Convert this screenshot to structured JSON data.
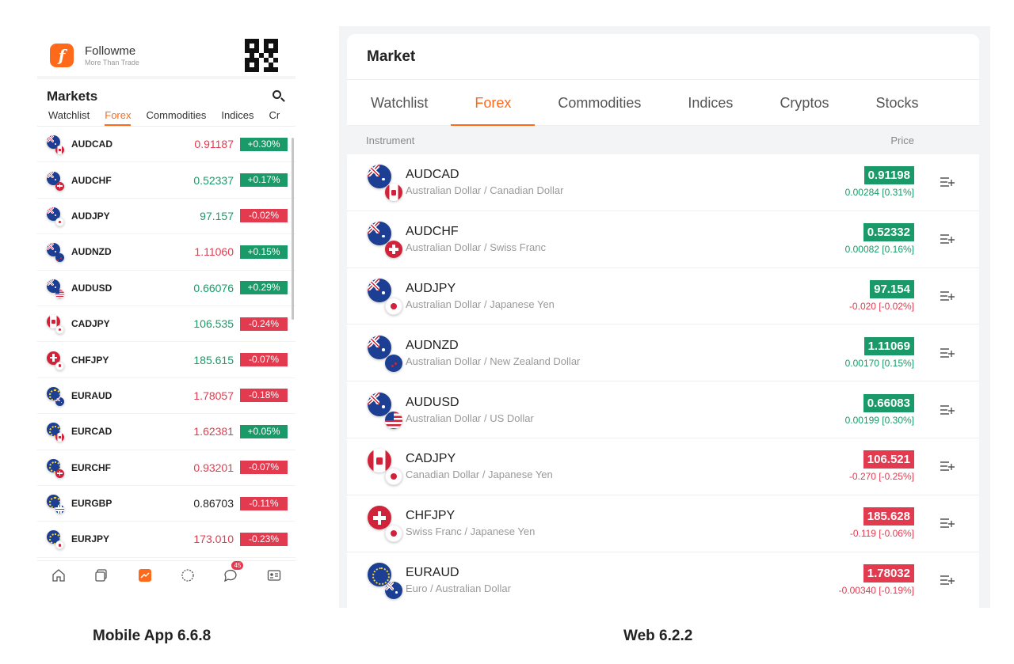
{
  "mobile": {
    "brand": {
      "name": "Followme",
      "tagline": "More Than Trade",
      "logo_icon": "followme-logo-icon"
    },
    "title": "Markets",
    "tabs": [
      {
        "label": "Watchlist"
      },
      {
        "label": "Forex",
        "active": true
      },
      {
        "label": "Commodities"
      },
      {
        "label": "Indices"
      },
      {
        "label": "Cr"
      }
    ],
    "rows": [
      {
        "symbol": "AUDCAD",
        "price": "0.91187",
        "price_dir": "dn",
        "change": "+0.30%",
        "change_dir": "up",
        "flags": [
          "au",
          "ca"
        ]
      },
      {
        "symbol": "AUDCHF",
        "price": "0.52337",
        "price_dir": "up",
        "change": "+0.17%",
        "change_dir": "up",
        "flags": [
          "au",
          "ch"
        ]
      },
      {
        "symbol": "AUDJPY",
        "price": "97.157",
        "price_dir": "up",
        "change": "-0.02%",
        "change_dir": "dn",
        "flags": [
          "au",
          "jp"
        ]
      },
      {
        "symbol": "AUDNZD",
        "price": "1.11060",
        "price_dir": "dn",
        "change": "+0.15%",
        "change_dir": "up",
        "flags": [
          "au",
          "nz"
        ]
      },
      {
        "symbol": "AUDUSD",
        "price": "0.66076",
        "price_dir": "up",
        "change": "+0.29%",
        "change_dir": "up",
        "flags": [
          "au",
          "us"
        ]
      },
      {
        "symbol": "CADJPY",
        "price": "106.535",
        "price_dir": "up",
        "change": "-0.24%",
        "change_dir": "dn",
        "flags": [
          "ca",
          "jp"
        ]
      },
      {
        "symbol": "CHFJPY",
        "price": "185.615",
        "price_dir": "up",
        "change": "-0.07%",
        "change_dir": "dn",
        "flags": [
          "ch",
          "jp"
        ]
      },
      {
        "symbol": "EURAUD",
        "price": "1.78057",
        "price_dir": "dn",
        "change": "-0.18%",
        "change_dir": "dn",
        "flags": [
          "eu",
          "au"
        ]
      },
      {
        "symbol": "EURCAD",
        "price": "1.62381",
        "price_dir": "dn",
        "change": "+0.05%",
        "change_dir": "up",
        "flags": [
          "eu",
          "ca"
        ]
      },
      {
        "symbol": "EURCHF",
        "price": "0.93201",
        "price_dir": "dn",
        "change": "-0.07%",
        "change_dir": "dn",
        "flags": [
          "eu",
          "ch"
        ]
      },
      {
        "symbol": "EURGBP",
        "price": "0.86703",
        "price_dir": "nt",
        "change": "-0.11%",
        "change_dir": "dn",
        "flags": [
          "eu",
          "gb"
        ]
      },
      {
        "symbol": "EURJPY",
        "price": "173.010",
        "price_dir": "dn",
        "change": "-0.23%",
        "change_dir": "dn",
        "flags": [
          "eu",
          "jp"
        ]
      }
    ],
    "nav": [
      {
        "icon": "home-icon"
      },
      {
        "icon": "copy-trade-icon"
      },
      {
        "icon": "markets-chart-icon",
        "active": true
      },
      {
        "icon": "community-icon"
      },
      {
        "icon": "messages-icon",
        "badge": "45"
      },
      {
        "icon": "profile-card-icon"
      }
    ],
    "caption": "Mobile App 6.6.8"
  },
  "web": {
    "title": "Market",
    "tabs": [
      {
        "label": "Watchlist"
      },
      {
        "label": "Forex",
        "active": true
      },
      {
        "label": "Commodities"
      },
      {
        "label": "Indices"
      },
      {
        "label": "Cryptos"
      },
      {
        "label": "Stocks"
      }
    ],
    "header": {
      "instrument": "Instrument",
      "price": "Price"
    },
    "rows": [
      {
        "symbol": "AUDCAD",
        "name": "Australian Dollar / Canadian Dollar",
        "price": "0.91198",
        "change": "0.00284 [0.31%]",
        "dir": "up",
        "flags": [
          "au",
          "ca"
        ]
      },
      {
        "symbol": "AUDCHF",
        "name": "Australian Dollar / Swiss Franc",
        "price": "0.52332",
        "change": "0.00082 [0.16%]",
        "dir": "up",
        "flags": [
          "au",
          "ch"
        ]
      },
      {
        "symbol": "AUDJPY",
        "name": "Australian Dollar / Japanese Yen",
        "price": "97.154",
        "change": "-0.020 [-0.02%]",
        "dir": "up",
        "change_dir": "dn",
        "flags": [
          "au",
          "jp"
        ]
      },
      {
        "symbol": "AUDNZD",
        "name": "Australian Dollar / New Zealand Dollar",
        "price": "1.11069",
        "change": "0.00170 [0.15%]",
        "dir": "up",
        "flags": [
          "au",
          "nz"
        ]
      },
      {
        "symbol": "AUDUSD",
        "name": "Australian Dollar / US Dollar",
        "price": "0.66083",
        "change": "0.00199 [0.30%]",
        "dir": "up",
        "flags": [
          "au",
          "us"
        ]
      },
      {
        "symbol": "CADJPY",
        "name": "Canadian Dollar / Japanese Yen",
        "price": "106.521",
        "change": "-0.270 [-0.25%]",
        "dir": "dn",
        "flags": [
          "ca",
          "jp"
        ]
      },
      {
        "symbol": "CHFJPY",
        "name": "Swiss Franc / Japanese Yen",
        "price": "185.628",
        "change": "-0.119 [-0.06%]",
        "dir": "dn",
        "flags": [
          "ch",
          "jp"
        ]
      },
      {
        "symbol": "EURAUD",
        "name": "Euro / Australian Dollar",
        "price": "1.78032",
        "change": "-0.00340 [-0.19%]",
        "dir": "dn",
        "flags": [
          "eu",
          "au"
        ]
      }
    ],
    "row_action_icon": "add-to-watchlist-icon",
    "caption": "Web 6.2.2"
  },
  "colors": {
    "accent": "#ff6a1a",
    "up": "#1a9a68",
    "down": "#e23b4f"
  }
}
